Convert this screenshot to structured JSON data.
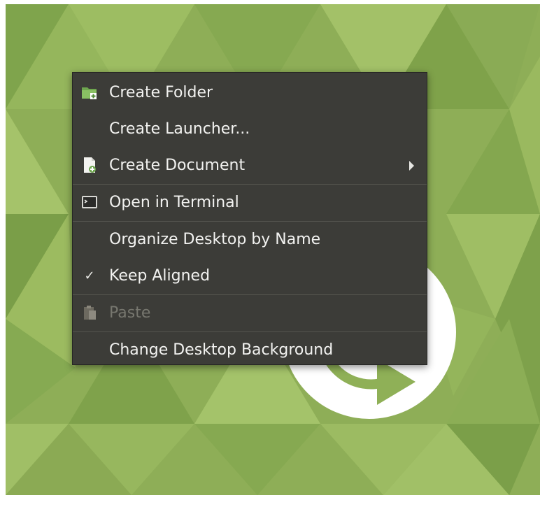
{
  "menu": {
    "items": [
      {
        "label": "Create Folder",
        "icon": "folder-new-icon",
        "enabled": true
      },
      {
        "label": "Create Launcher...",
        "icon": "",
        "enabled": true
      },
      {
        "label": "Create Document",
        "icon": "document-new-icon",
        "enabled": true,
        "submenu": true
      },
      {
        "label": "Open in Terminal",
        "icon": "terminal-icon",
        "enabled": true
      },
      {
        "label": "Organize Desktop by Name",
        "icon": "",
        "enabled": true
      },
      {
        "label": "Keep Aligned",
        "icon": "checkmark-icon",
        "enabled": true,
        "checked": true
      },
      {
        "label": "Paste",
        "icon": "clipboard-paste-icon",
        "enabled": false
      },
      {
        "label": "Change Desktop Background",
        "icon": "",
        "enabled": true
      }
    ],
    "checkmark_glyph": "✓"
  },
  "colors": {
    "menu_bg": "#3c3c38",
    "menu_text": "#f2f2f0",
    "disabled_text": "#77776f",
    "desktop_green": "#8fb057",
    "folder_green": "#6aa84f"
  }
}
